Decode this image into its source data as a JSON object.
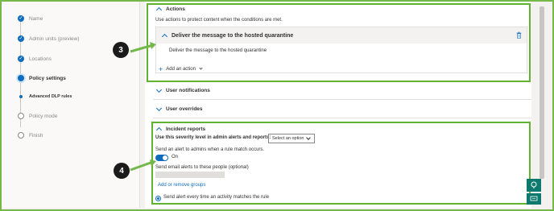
{
  "wizard": {
    "steps": [
      {
        "label": "Name",
        "state": "done"
      },
      {
        "label": "Admin units (preview)",
        "state": "done"
      },
      {
        "label": "Locations",
        "state": "done"
      },
      {
        "label": "Policy settings",
        "state": "current"
      },
      {
        "label": "Advanced DLP rules",
        "state": "sub"
      },
      {
        "label": "Policy mode",
        "state": "todo"
      },
      {
        "label": "Finish",
        "state": "todo"
      }
    ]
  },
  "actions": {
    "header": "Actions",
    "description": "Use actions to protect content when the conditions are met.",
    "item_title": "Deliver the message to the hosted quarantine",
    "item_detail": "Deliver the message to the hosted quarantine",
    "add_action": "Add an action"
  },
  "user_notifications": "User notifications",
  "user_overrides": "User overrides",
  "incident": {
    "header": "Incident reports",
    "severity_label": "Use this severity level in admin alerts and reports:",
    "severity_placeholder": "Select an option",
    "alert_label": "Send an alert to admins when a rule match occurs.",
    "toggle_text": "On",
    "email_label": "Send email alerts to these people (optional)",
    "add_groups": "Add or remove groups",
    "radio_label": "Send alert every time an activity matches the rule"
  },
  "callouts": {
    "a": "3",
    "b": "4"
  },
  "colors": {
    "accent": "#0f6cbd",
    "highlight": "#5fb331"
  },
  "icons": {
    "trash": "trash-icon",
    "help": "help-icon",
    "chat": "chat-icon"
  }
}
